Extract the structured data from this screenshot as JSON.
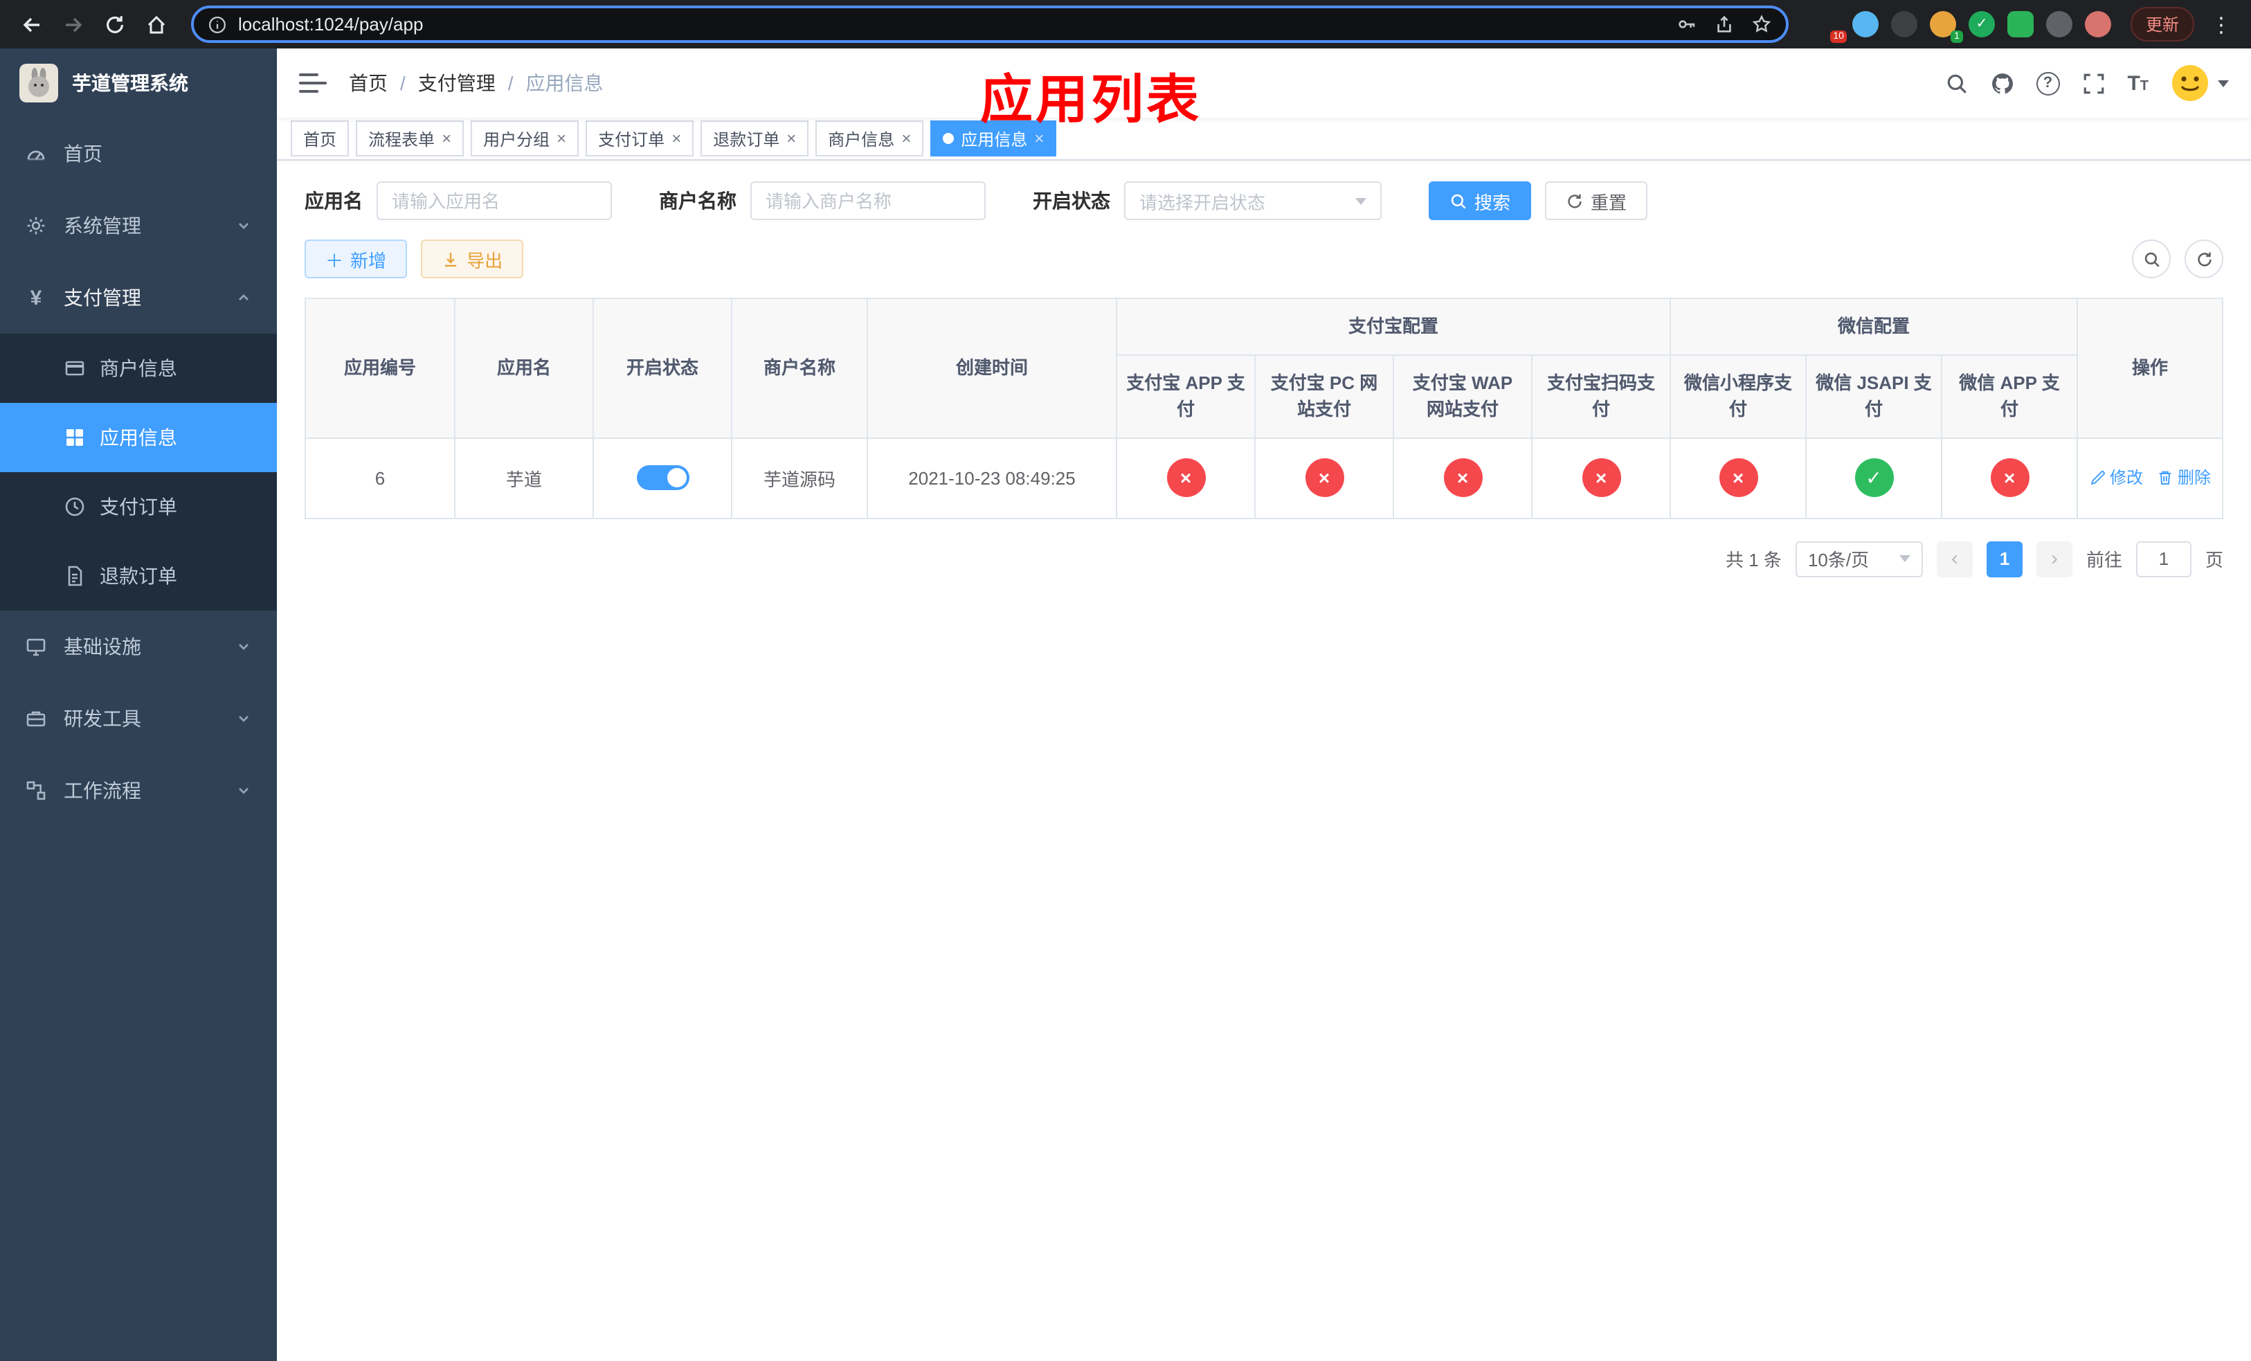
{
  "theme": {
    "accent": "#409eff",
    "danger": "#f5484d",
    "success": "#2dbd5f",
    "sidebar-bg": "#304156",
    "sidebar-sub-bg": "#1f2d3d",
    "annotation": "#ff0000"
  },
  "browser": {
    "url": "localhost:1024/pay/app",
    "update_label": "更新",
    "ext_badge_grid": "10",
    "ext_badge_avatar": "1"
  },
  "sidebar": {
    "title": "芋道管理系统",
    "menu": [
      {
        "label": "首页"
      },
      {
        "label": "系统管理"
      },
      {
        "label": "支付管理"
      },
      {
        "label": "基础设施"
      },
      {
        "label": "研发工具"
      },
      {
        "label": "工作流程"
      }
    ],
    "submenu": [
      {
        "label": "商户信息"
      },
      {
        "label": "应用信息"
      },
      {
        "label": "支付订单"
      },
      {
        "label": "退款订单"
      }
    ]
  },
  "navbar": {
    "breadcrumb": [
      "首页",
      "支付管理",
      "应用信息"
    ],
    "separator": "/",
    "annotation": "应用列表"
  },
  "tabs": [
    {
      "label": "首页"
    },
    {
      "label": "流程表单"
    },
    {
      "label": "用户分组"
    },
    {
      "label": "支付订单"
    },
    {
      "label": "退款订单"
    },
    {
      "label": "商户信息"
    },
    {
      "label": "应用信息"
    }
  ],
  "filters": {
    "app_name_label": "应用名",
    "app_name_placeholder": "请输入应用名",
    "merchant_label": "商户名称",
    "merchant_placeholder": "请输入商户名称",
    "status_label": "开启状态",
    "status_placeholder": "请选择开启状态",
    "search_label": "搜索",
    "reset_label": "重置"
  },
  "toolbar": {
    "add_label": "新增",
    "export_label": "导出"
  },
  "table": {
    "headers": {
      "app_id": "应用编号",
      "app_name": "应用名",
      "status": "开启状态",
      "merchant": "商户名称",
      "created": "创建时间",
      "alipay_group": "支付宝配置",
      "wechat_group": "微信配置",
      "alipay_app": "支付宝 APP 支付",
      "alipay_pc": "支付宝 PC 网站支付",
      "alipay_wap": "支付宝 WAP 网站支付",
      "alipay_qr": "支付宝扫码支付",
      "wx_mini": "微信小程序支付",
      "wx_jsapi": "微信 JSAPI 支付",
      "wx_app": "微信 APP 支付",
      "actions": "操作"
    },
    "row": {
      "app_id": "6",
      "app_name": "芋道",
      "status_on": true,
      "merchant": "芋道源码",
      "created": "2021-10-23 08:49:25",
      "configs": [
        false,
        false,
        false,
        false,
        false,
        true,
        false
      ],
      "edit_label": "修改",
      "delete_label": "删除"
    }
  },
  "pagination": {
    "total_text": "共 1 条",
    "page_size": "10条/页",
    "current_page": "1",
    "goto_prefix": "前往",
    "goto_value": "1",
    "goto_suffix": "页"
  }
}
